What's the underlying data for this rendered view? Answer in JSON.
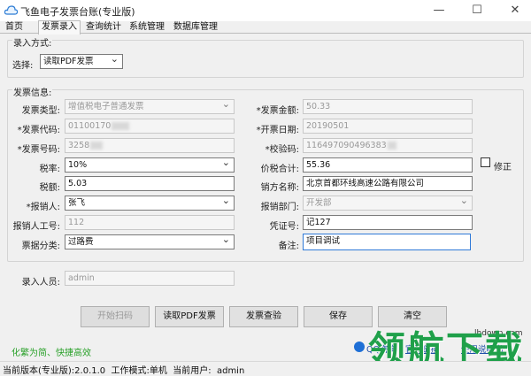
{
  "window": {
    "title": "飞鱼电子发票台账(专业版)",
    "minimize_glyph": "—",
    "maximize_glyph": "☐",
    "close_glyph": "✕"
  },
  "tabs": [
    {
      "label": "首页"
    },
    {
      "label": "发票录入"
    },
    {
      "label": "查询统计"
    },
    {
      "label": "系统管理"
    },
    {
      "label": "数据库管理"
    }
  ],
  "entry": {
    "group_label": "录入方式:",
    "select_label": "选择:",
    "select_value": "读取PDF发票"
  },
  "invoice": {
    "group_label": "发票信息:",
    "type_label": "发票类型:",
    "type_value": "增值税电子普通发票",
    "amount_label": "*发票金额:",
    "amount_value": "50.33",
    "code_label": "*发票代码:",
    "code_value": "01100170",
    "date_label": "*开票日期:",
    "date_value": "20190501",
    "number_label": "*发票号码:",
    "number_value": "3258",
    "check_label": "*校验码:",
    "check_value": "116497090496383",
    "tax_rate_label": "税率:",
    "tax_rate_value": "10%",
    "total_label": "价税合计:",
    "total_value": "55.36",
    "correct_label": "修正",
    "tax_label": "税额:",
    "tax_value": "5.03",
    "seller_label": "销方名称:",
    "seller_value": "北京首都环线高速公路有限公司",
    "reporter_label": "*报销人:",
    "reporter_value": "张飞",
    "dept_label": "报销部门:",
    "dept_value": "开发部",
    "emp_id_label": "报销人工号:",
    "emp_id_value": "112",
    "voucher_label": "凭证号:",
    "voucher_value": "记127",
    "category_label": "票据分类:",
    "category_value": "过路费",
    "remark_label": "备注:",
    "remark_value": "项目调试"
  },
  "entry_person": {
    "label": "录入人员:",
    "value": "admin"
  },
  "buttons": {
    "scan": "开始扫码",
    "read_pdf": "读取PDF发票",
    "verify": "发票查验",
    "save": "保存",
    "clear": "清空"
  },
  "footer": {
    "slogan": "化繁为简、快捷高效",
    "qq_label": "QQ咨询",
    "link_text": "官网链接",
    "help_text": "使用说明书"
  },
  "statusbar": {
    "text": "当前版本(专业版):2.0.1.0  工作模式:单机  当前用户:  admin"
  },
  "watermark": {
    "site": "lhdown.com",
    "brand": "领航下载"
  }
}
